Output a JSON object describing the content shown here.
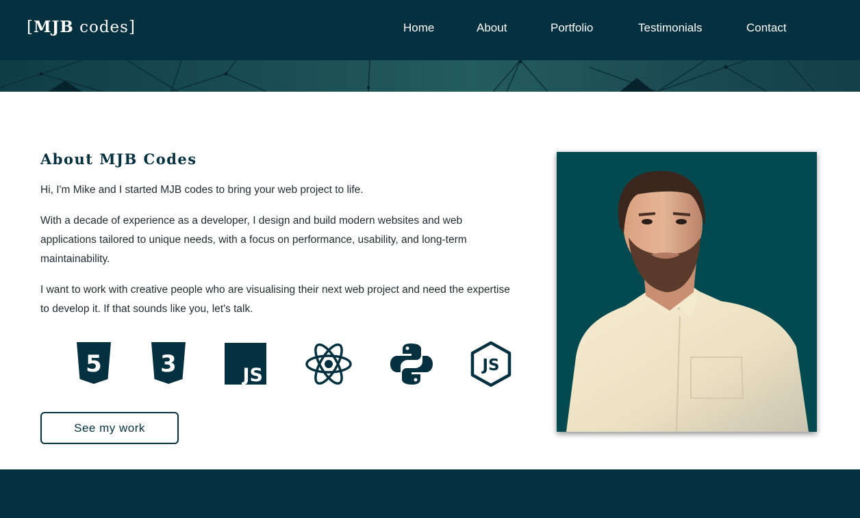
{
  "header": {
    "logo_bracket_open": "[",
    "logo_bold": "MJB",
    "logo_rest": " codes",
    "logo_bracket_close": "]",
    "nav": [
      {
        "label": "Home"
      },
      {
        "label": "About"
      },
      {
        "label": "Portfolio"
      },
      {
        "label": "Testimonials"
      },
      {
        "label": "Contact"
      }
    ]
  },
  "about": {
    "title": "About MJB Codes",
    "paragraphs": [
      "Hi, I'm Mike and I started MJB codes to bring your web project to life.",
      "With a decade of experience as a developer, I design and build modern websites and web applications tailored to unique needs, with a focus on performance, usability, and long-term maintainability.",
      "I want to work with creative people who are visualising their next web project and need the expertise to develop it. If that sounds like you, let's talk."
    ],
    "skills": [
      {
        "icon": "html5-icon",
        "label": "5"
      },
      {
        "icon": "css3-icon",
        "label": "3"
      },
      {
        "icon": "javascript-icon",
        "label": "JS"
      },
      {
        "icon": "react-icon"
      },
      {
        "icon": "python-icon"
      },
      {
        "icon": "nodejs-icon",
        "label": "JS"
      }
    ],
    "cta_label": "See my work"
  },
  "colors": {
    "primary": "#04303f",
    "photo_bg": "#024a4f",
    "text": "#1f2a2e"
  }
}
